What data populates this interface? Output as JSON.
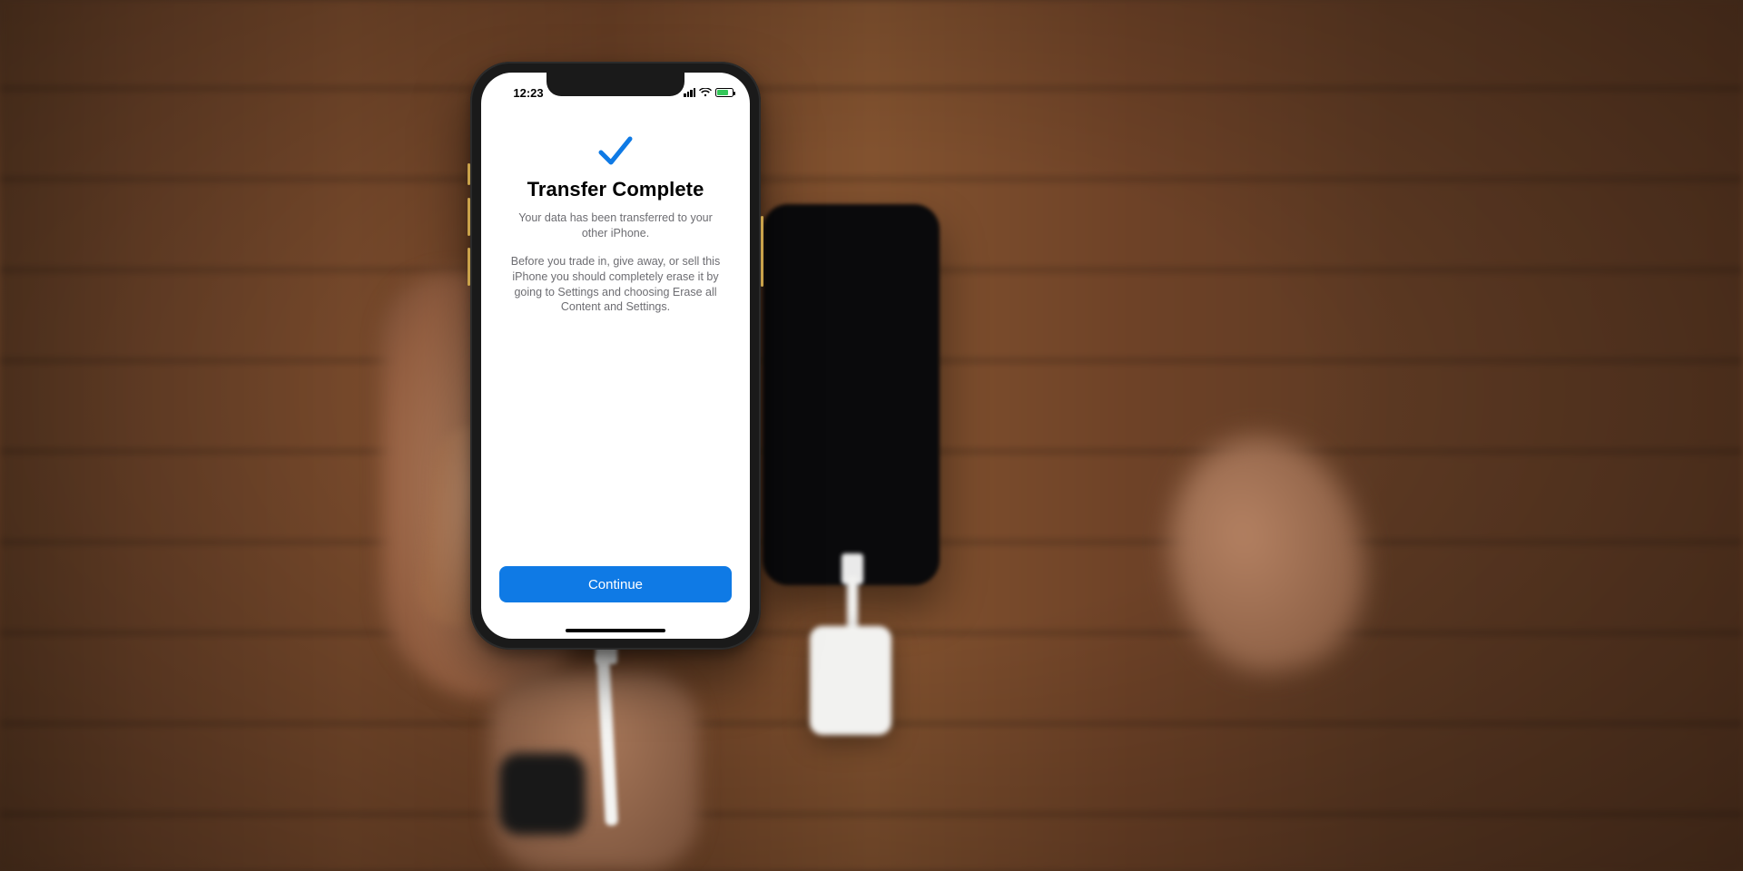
{
  "status_bar": {
    "time": "12:23",
    "battery_percent": 65,
    "battery_charging": true
  },
  "screen": {
    "icon": "checkmark-icon",
    "title": "Transfer Complete",
    "subtitle1": "Your data has been transferred to your other iPhone.",
    "subtitle2": "Before you trade in, give away, or sell this iPhone you should completely erase it by going to Settings and choosing Erase all Content and Settings.",
    "primary_button": "Continue"
  },
  "colors": {
    "accent": "#0f7ae5",
    "success": "#34c759",
    "text_secondary": "#6d6d72"
  }
}
